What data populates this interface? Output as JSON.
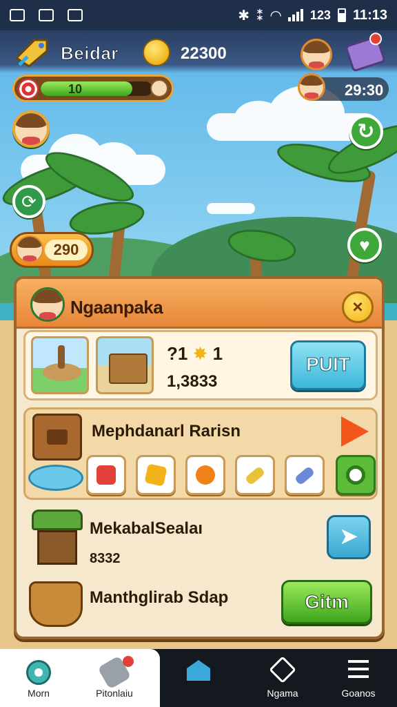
{
  "status_bar": {
    "time": "11:13",
    "network": "123"
  },
  "hud": {
    "title": "Beidar",
    "coins": "22300",
    "xp_level": "10",
    "xp_progress": 0.82,
    "friend_score": "29:30",
    "gems": "290"
  },
  "panel": {
    "title": "Ngaanpaka",
    "close_label": "×",
    "offer": {
      "stars_prefix": "?1",
      "stars_suffix": "1",
      "amount": "1,3833",
      "button": "PUIT"
    },
    "recipe": {
      "title": "Mephdanarl Rarisn",
      "items": [
        "brick",
        "toy-blocks",
        "fruit",
        "rolling-pin",
        "telescope",
        "ring"
      ]
    },
    "market": {
      "title1": "MekabalSealaı",
      "count": "8332",
      "title2": "Manthglirab Sdap",
      "button": "Gitm"
    }
  },
  "bottom_nav": [
    {
      "label": "Morn",
      "icon": "home-badge-icon"
    },
    {
      "label": "Pitonlaiu",
      "icon": "tag-icon"
    },
    {
      "label": "",
      "icon": "house-icon"
    },
    {
      "label": "Ngama",
      "icon": "diamond-tag-icon"
    },
    {
      "label": "Goanos",
      "icon": "menu-icon"
    }
  ],
  "colors": {
    "accent_orange": "#e8863a",
    "accent_green": "#3ea61e",
    "accent_blue": "#3cb6d8",
    "panel_bg": "#f6e8cc"
  }
}
